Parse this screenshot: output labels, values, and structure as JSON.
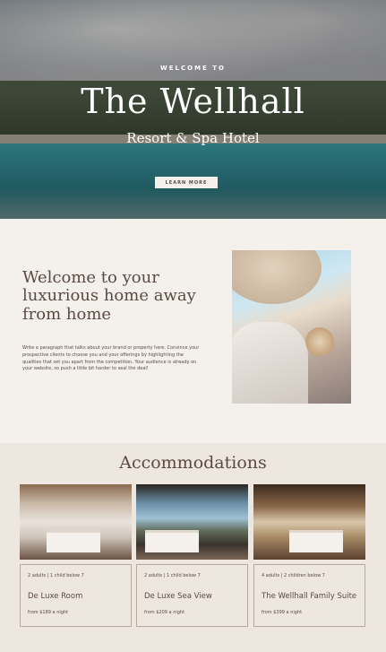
{
  "hero": {
    "welcome_to": "WELCOME TO",
    "title": "The Wellhall",
    "subtitle": "Resort & Spa Hotel",
    "button": "LEARN MORE"
  },
  "intro": {
    "title": "Welcome to your luxurious home away from home",
    "text": "Write a paragraph that talks about your brand or property here. Convince your prospective clients to choose you and your offerings by highlighting the qualities that set you apart from the competition. Your audience is already on your website, so push a little bit harder to seal the deal!"
  },
  "accommodations": {
    "title": "Accommodations",
    "rooms": [
      {
        "meta": "2 adults | 1 child below 7",
        "name": "De Luxe Room",
        "price": "from $189 a night"
      },
      {
        "meta": "2 adults | 1 child below 7",
        "name": "De Luxe Sea View",
        "price": "from $209 a night"
      },
      {
        "meta": "4 adults | 2 children below 7",
        "name": "The Wellhall Family Suite",
        "price": "from $399 a night"
      }
    ]
  },
  "colors": {
    "background": "#f4f1ec",
    "section_alt": "#ede7e0",
    "text": "#5b4a42",
    "card_border": "#b9a99c"
  }
}
